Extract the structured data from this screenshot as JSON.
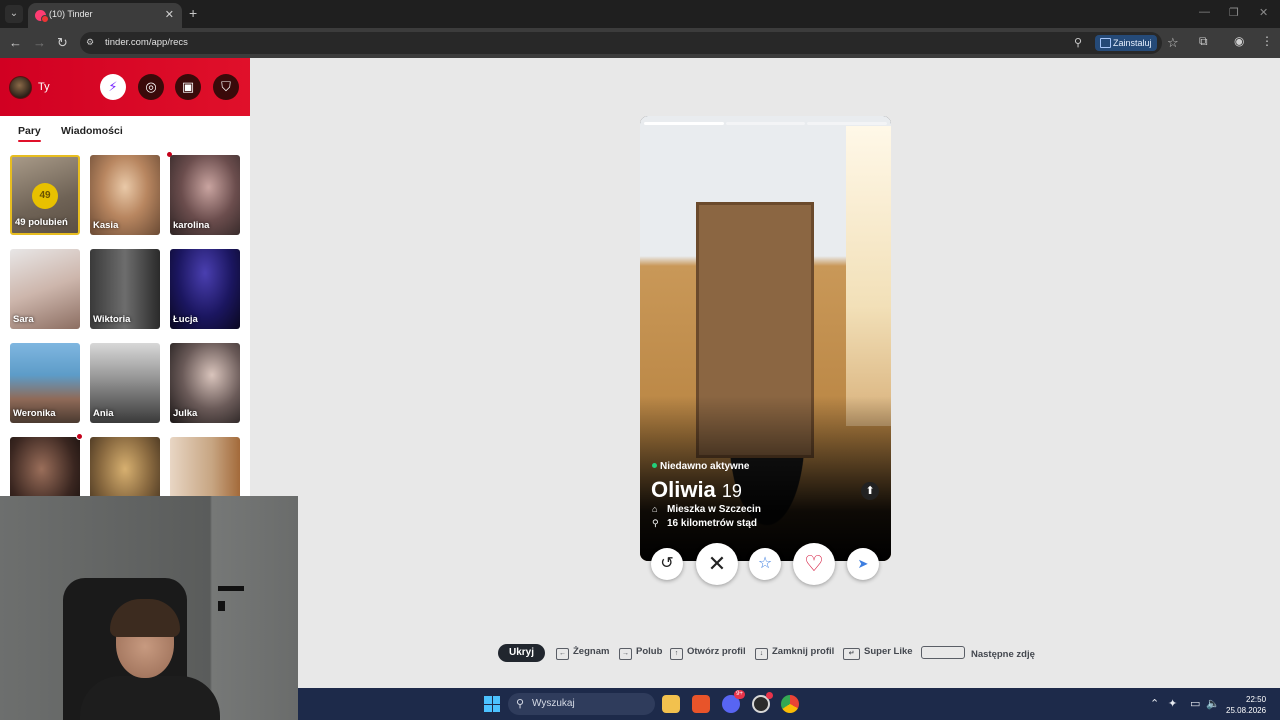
{
  "browser": {
    "tab_title": "(10) Tinder",
    "tab_close": "✕",
    "new_tab": "+",
    "url": "tinder.com/app/recs",
    "install_label": "Zainstaluj",
    "window_controls": [
      "—",
      "❐",
      "✕"
    ]
  },
  "sidebar": {
    "user_name": "Ty",
    "tabs": [
      "Pary",
      "Wiadomości"
    ],
    "likes": {
      "count": "49",
      "label": "49 polubień"
    },
    "matches": [
      {
        "name": "Kasia",
        "unread": true
      },
      {
        "name": "karolina",
        "unread": false
      },
      {
        "name": "Sara",
        "unread": false
      },
      {
        "name": "Wiktoria",
        "unread": false
      },
      {
        "name": "Łucja",
        "unread": false
      },
      {
        "name": "Weronika",
        "unread": false
      },
      {
        "name": "Ania",
        "unread": false
      },
      {
        "name": "Julka",
        "unread": false
      },
      {
        "name": "",
        "unread": true
      },
      {
        "name": "",
        "unread": false
      },
      {
        "name": "",
        "unread": false
      }
    ]
  },
  "profile": {
    "status": "Niedawno aktywne",
    "name": "Oliwia",
    "age": "19",
    "lives_in": "Mieszka w Szczecin",
    "distance": "16 kilometrów stąd",
    "photo_count": 3,
    "current_photo": 1
  },
  "actions": {
    "rewind_icon": "↺",
    "nope_icon": "✕",
    "superlike_icon": "☆",
    "like_icon": "♡",
    "boost_icon": "➤"
  },
  "shortcuts": {
    "hide_label": "Ukryj",
    "nope": "Żegnam",
    "like": "Polub",
    "open_profile": "Otwórz profil",
    "close_profile": "Zamknij profil",
    "super_like": "Super Like",
    "next_photo": "Następne zdję"
  },
  "taskbar": {
    "search_label": "Wyszukaj",
    "discord_badge": "9+",
    "time": "22:50",
    "date": "25.08.2026"
  },
  "colors": {
    "tinder_red": "#e0102a",
    "likes_gold": "#e8c100",
    "online_green": "#21d07a"
  }
}
